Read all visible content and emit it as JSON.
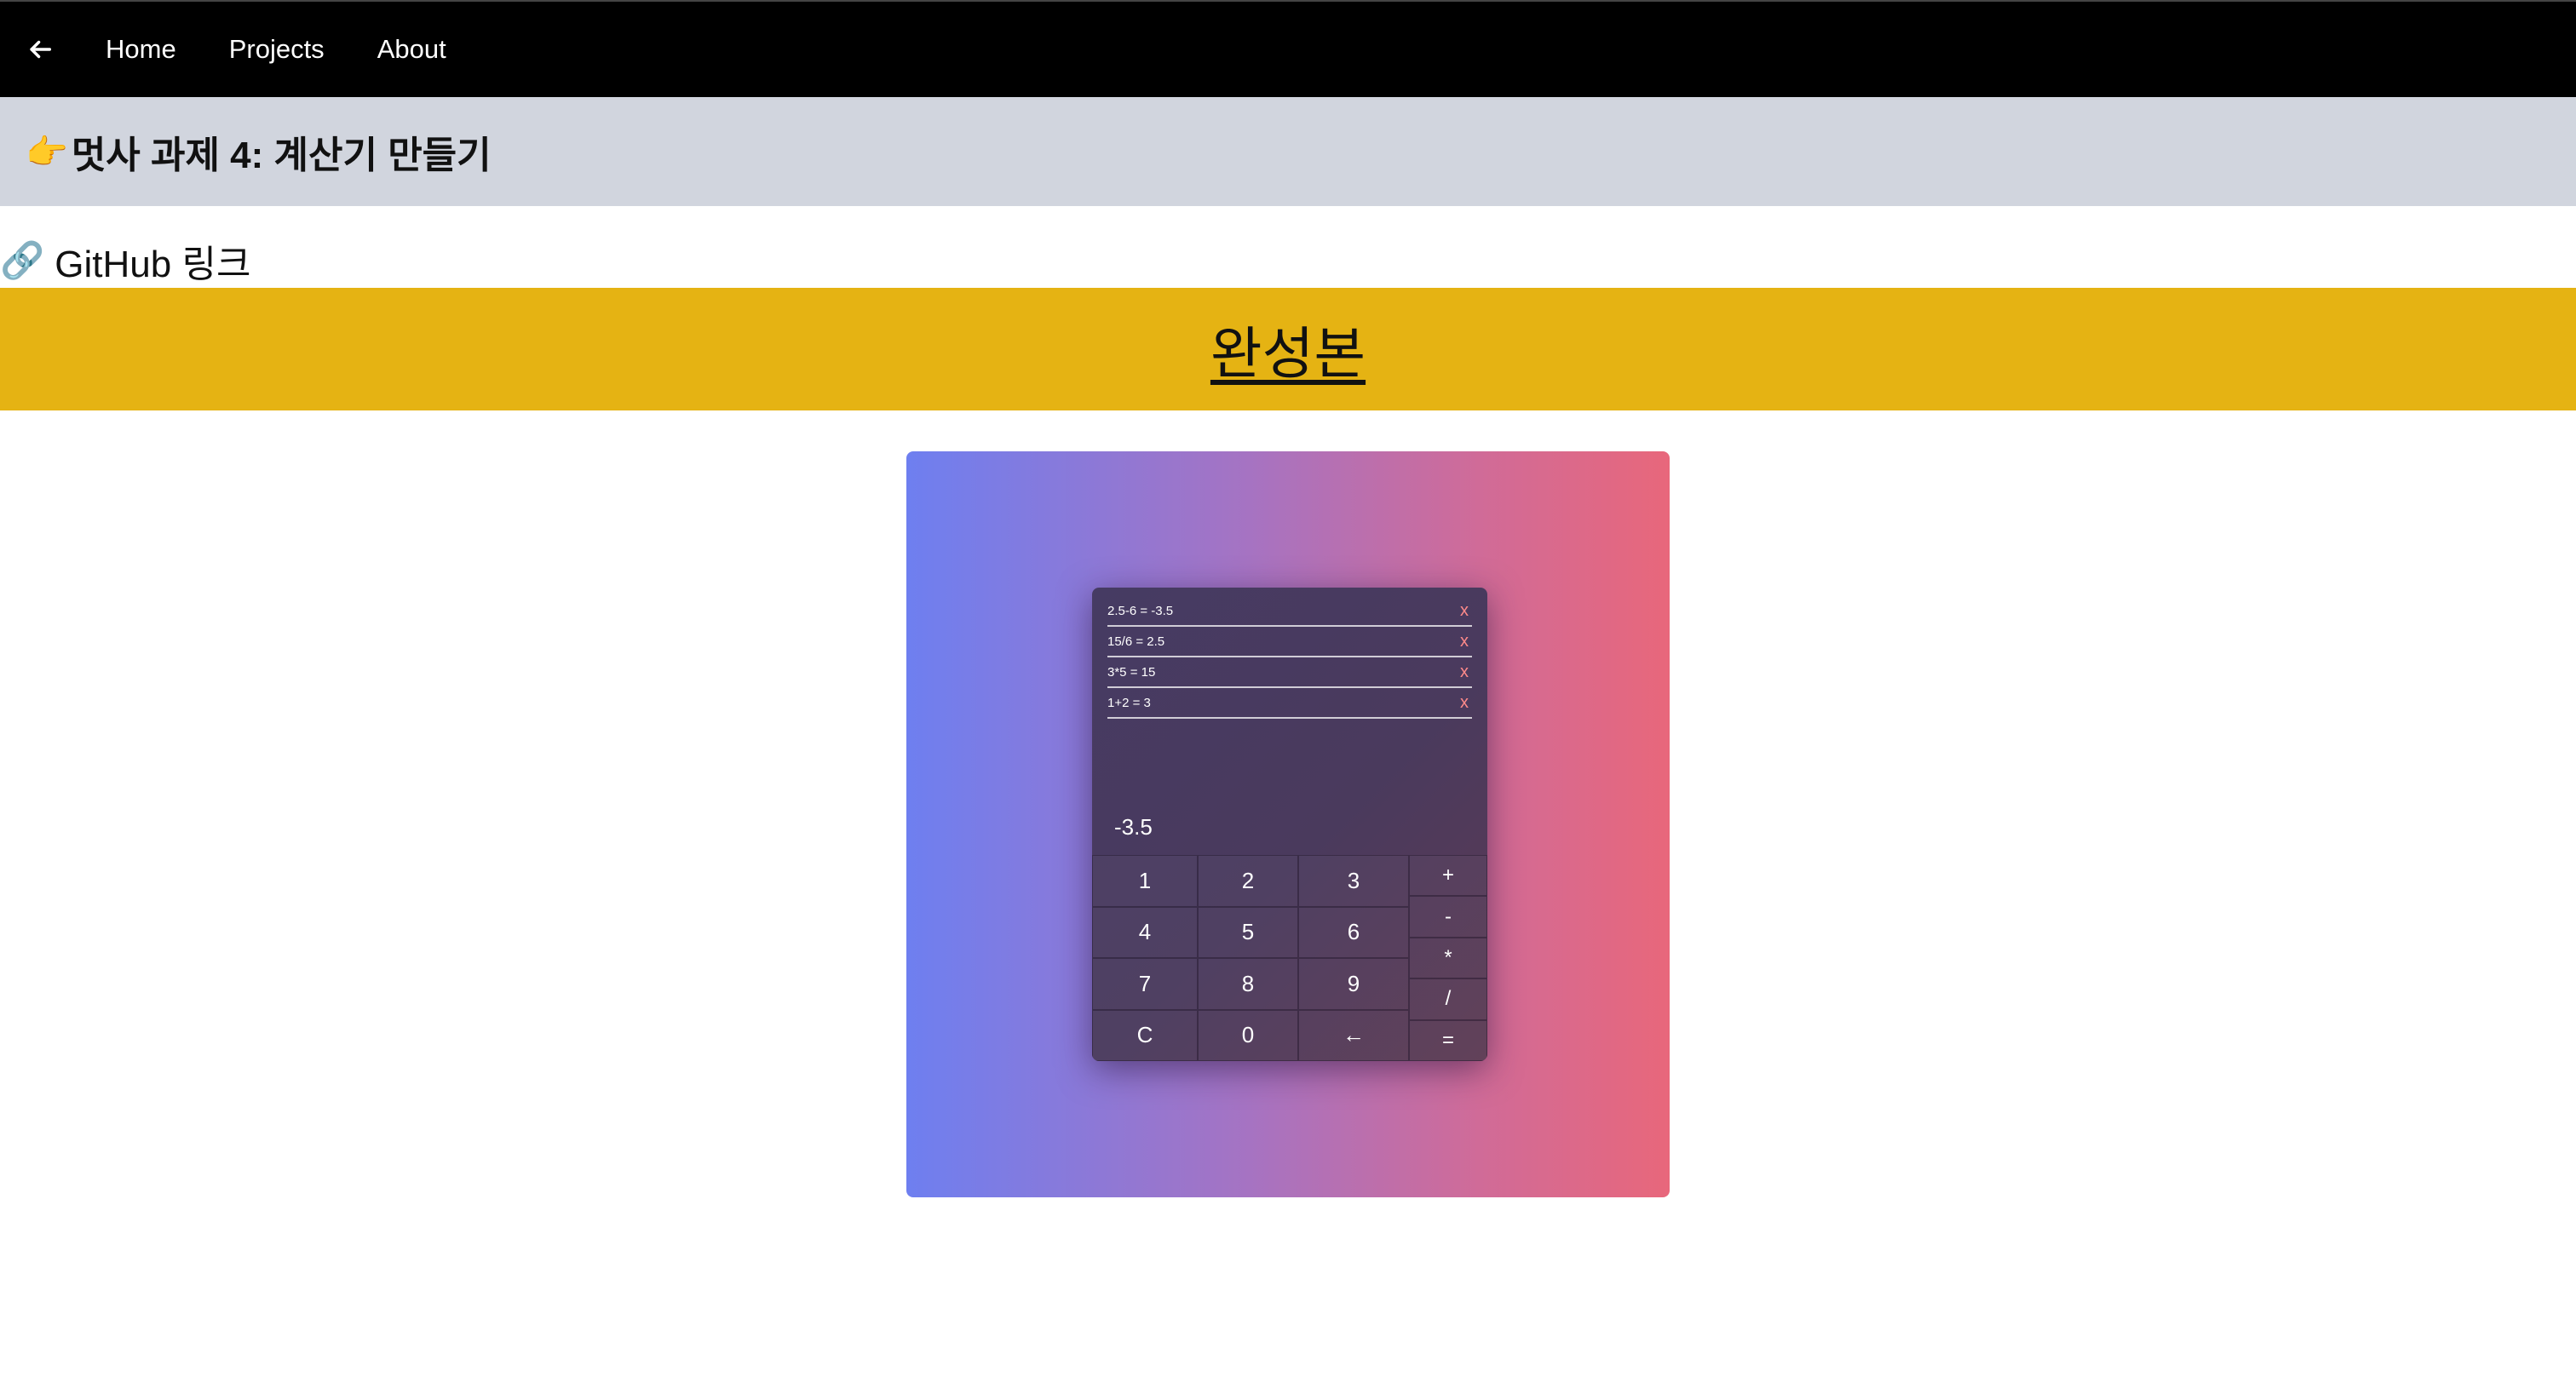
{
  "nav": {
    "back_icon": "arrow-left-icon",
    "links": [
      "Home",
      "Projects",
      "About"
    ]
  },
  "page": {
    "title_emoji": "👉",
    "title": "멋사 과제 4: 계산기 만들기",
    "github_emoji": "🔗",
    "github_link": "GitHub 링크",
    "banner_link": "완성본",
    "banner_color": "#e5b313"
  },
  "calculator": {
    "history": [
      {
        "expr": "2.5-6 = -3.5",
        "delete": "x"
      },
      {
        "expr": "15/6 = 2.5",
        "delete": "x"
      },
      {
        "expr": "3*5 = 15",
        "delete": "x"
      },
      {
        "expr": "1+2 = 3",
        "delete": "x"
      }
    ],
    "display": "-3.5",
    "keys": [
      "1",
      "2",
      "3",
      "4",
      "5",
      "6",
      "7",
      "8",
      "9",
      "C",
      "0",
      "←"
    ],
    "operators": [
      "+",
      "-",
      "*",
      "/",
      "="
    ]
  },
  "colors": {
    "gradient_start": "#6e7ff0",
    "gradient_end": "#e8677b"
  }
}
